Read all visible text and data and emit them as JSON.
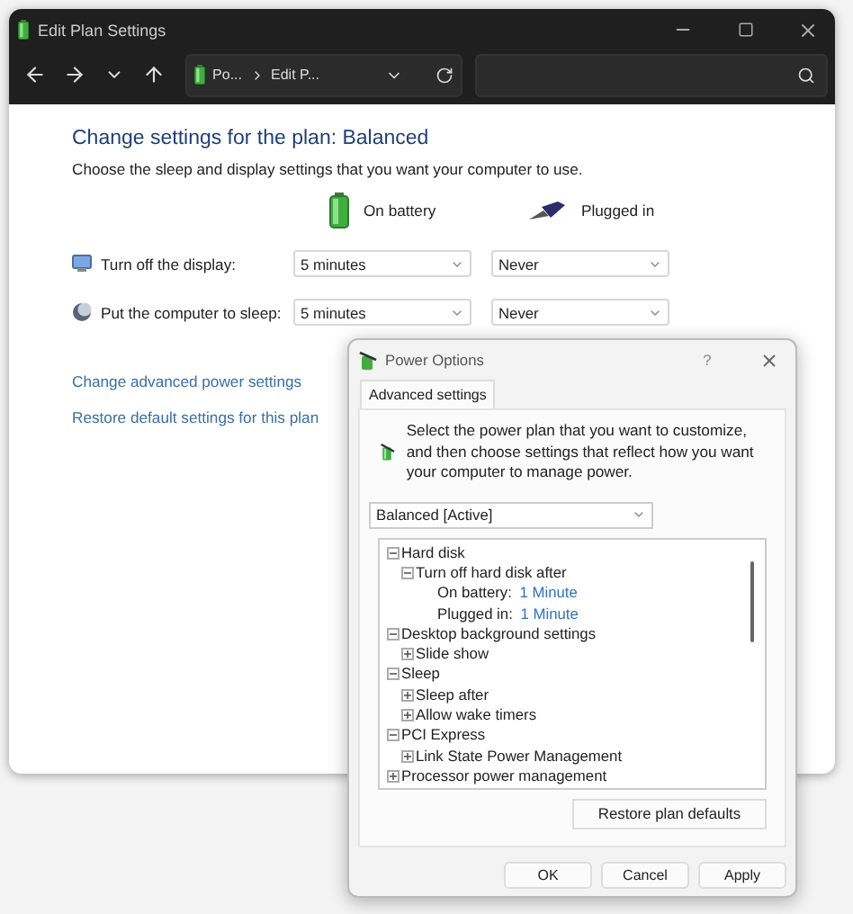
{
  "window": {
    "title": "Edit Plan Settings"
  },
  "address_bar": {
    "crumbs": [
      "Po...",
      "Edit P..."
    ]
  },
  "heading": "Change settings for the plan: Balanced",
  "description": "Choose the sleep and display settings that you want your computer to use.",
  "columns": [
    "On battery",
    "Plugged in"
  ],
  "settings": [
    {
      "label": "Turn off the display:",
      "values": [
        "5 minutes",
        "Never"
      ]
    },
    {
      "label": "Put the computer to sleep:",
      "values": [
        "5 minutes",
        "Never"
      ]
    }
  ],
  "links": [
    "Change advanced power settings",
    "Restore default settings for this plan"
  ],
  "dialog": {
    "title": "Power Options",
    "help": "?",
    "tabs": [
      {
        "label": "Advanced settings",
        "selected": true
      }
    ],
    "intro": "Select the power plan that you want to customize, and then choose settings that reflect how you want your computer to manage power.",
    "plan": "Balanced [Active]",
    "tree": [
      {
        "label": "Hard disk",
        "expanded": true,
        "children": [
          {
            "label": "Turn off hard disk after",
            "expanded": true,
            "children": [
              {
                "label": "On battery:",
                "value": "1 Minute"
              },
              {
                "label": "Plugged in:",
                "value": "1 Minute"
              }
            ]
          }
        ]
      },
      {
        "label": "Desktop background settings",
        "expanded": true,
        "children": [
          {
            "label": "Slide show",
            "expanded": false
          }
        ]
      },
      {
        "label": "Sleep",
        "expanded": true,
        "children": [
          {
            "label": "Sleep after",
            "expanded": false
          },
          {
            "label": "Allow wake timers",
            "expanded": false
          }
        ]
      },
      {
        "label": "PCI Express",
        "expanded": true,
        "children": [
          {
            "label": "Link State Power Management",
            "expanded": false
          }
        ]
      },
      {
        "label": "Processor power management",
        "expanded": false
      }
    ],
    "restore_button": "Restore plan defaults",
    "buttons": [
      "OK",
      "Cancel",
      "Apply"
    ]
  }
}
